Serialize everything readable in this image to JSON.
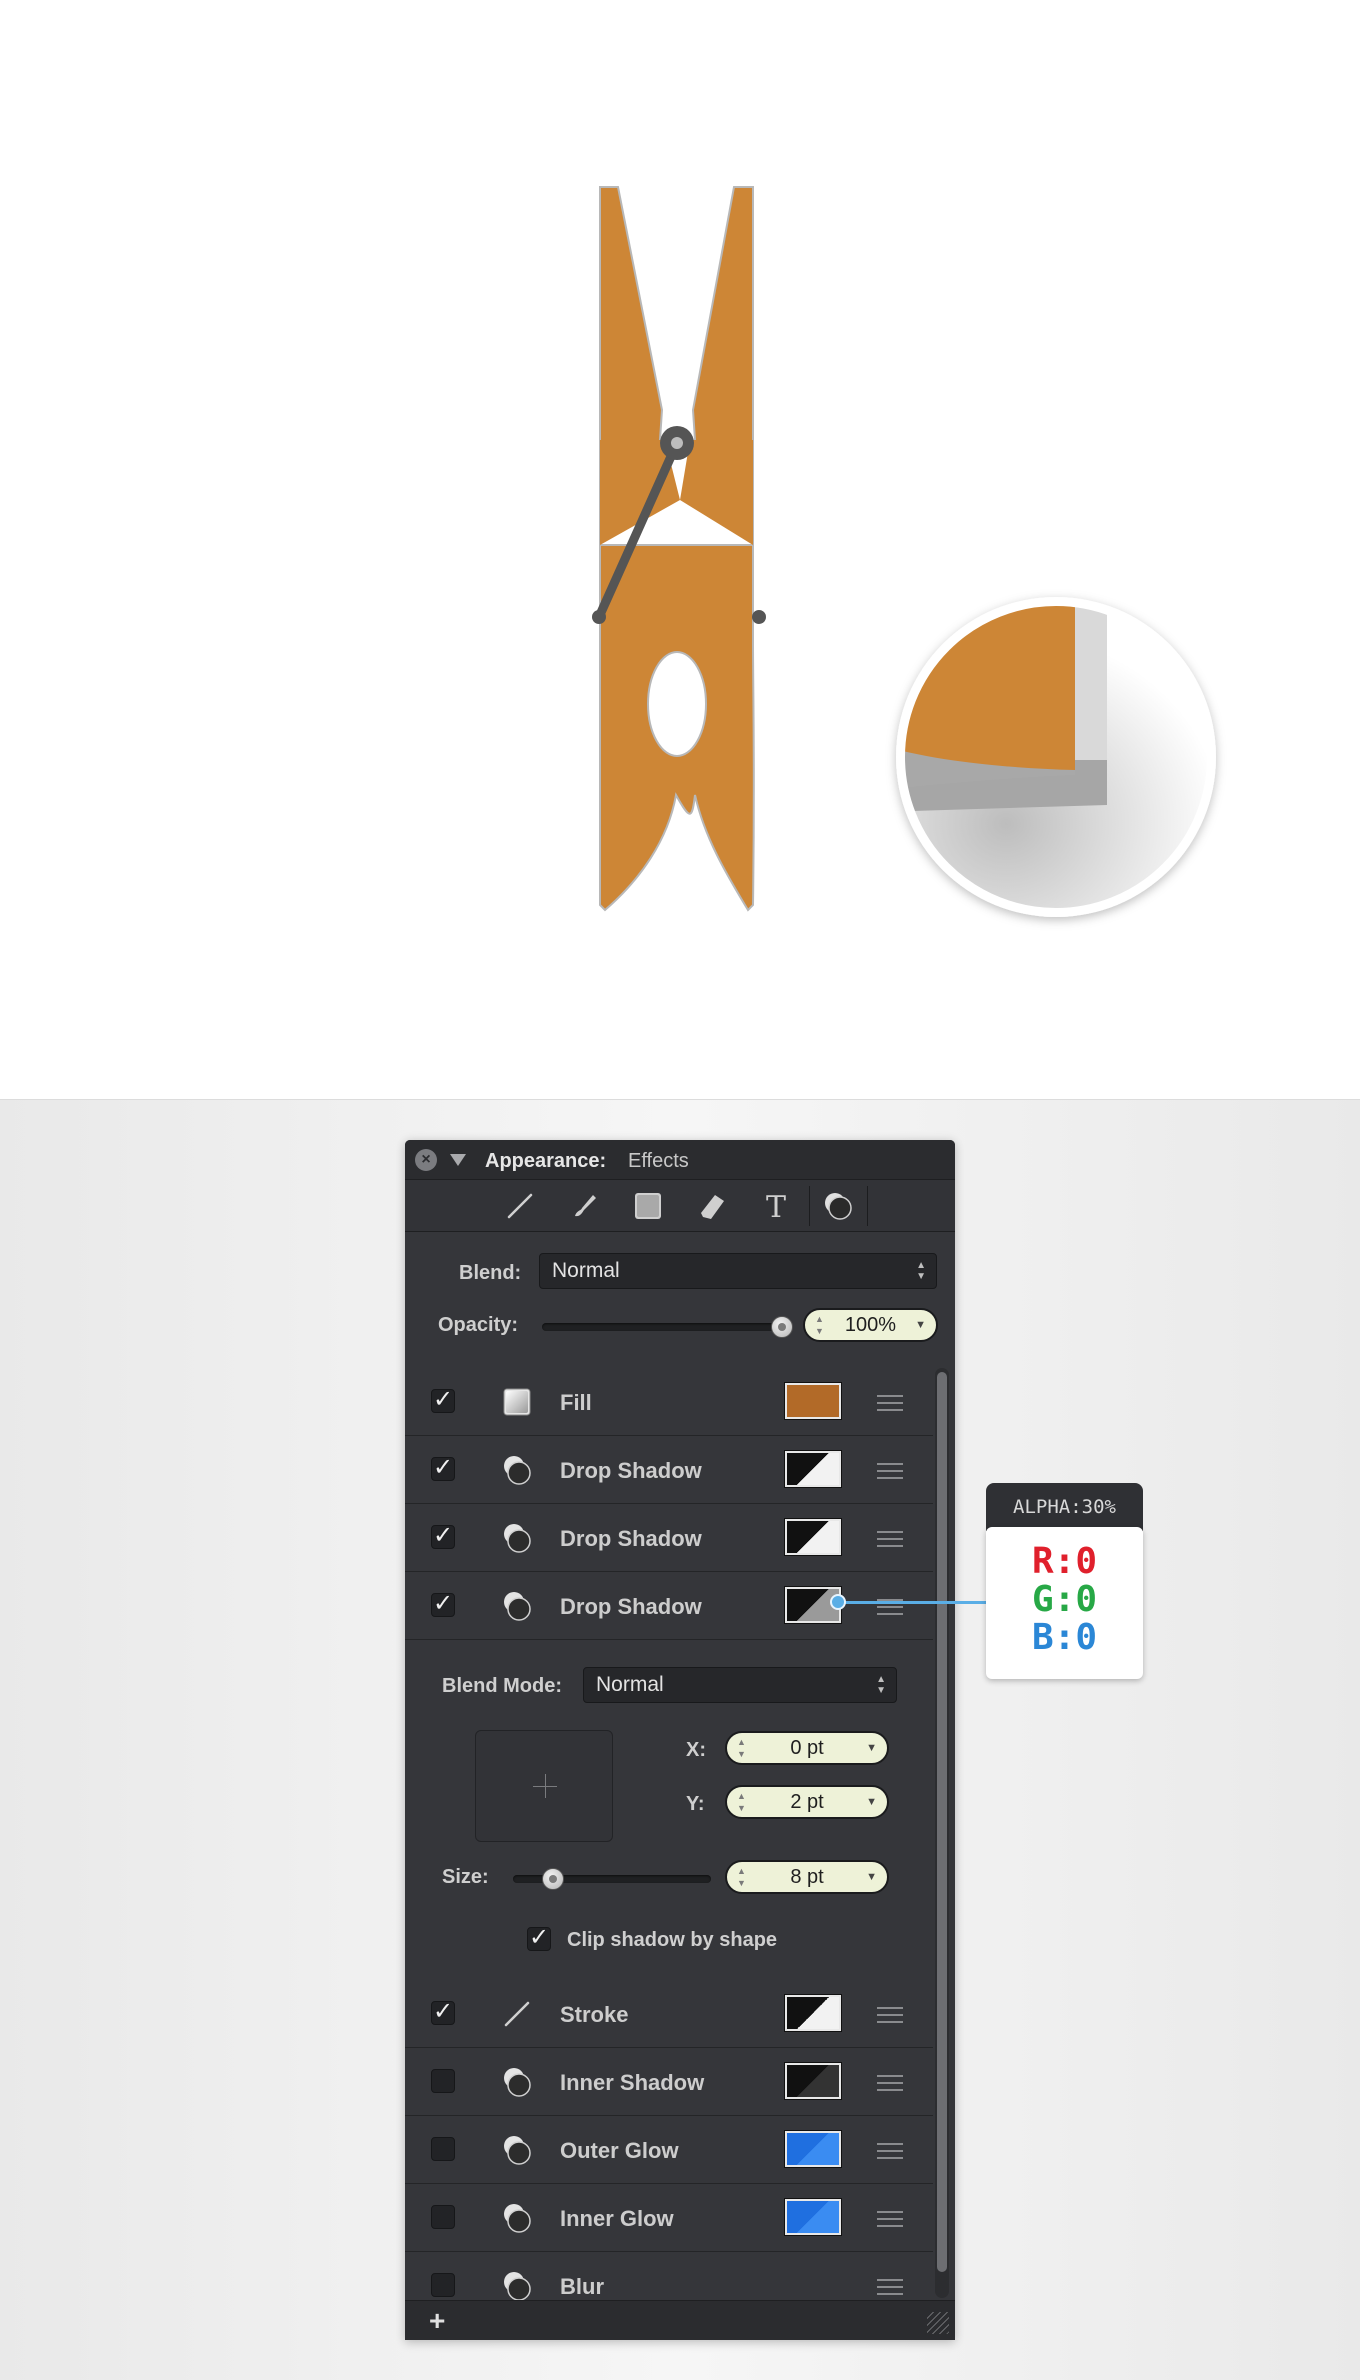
{
  "panel": {
    "title": "Appearance:",
    "subtitle": "Effects",
    "tools": [
      "stroke-tool-icon",
      "brush-tool-icon",
      "fill-tool-icon",
      "tag-tool-icon",
      "text-tool-icon",
      "effects-tool-icon"
    ],
    "blend_label": "Blend:",
    "blend_value": "Normal",
    "opacity_label": "Opacity:",
    "opacity_value": "100%",
    "opacity_fraction": 1.0,
    "effects": [
      {
        "label": "Fill",
        "checked": true,
        "icon": "fill-square-icon",
        "swatch": "#b26a28"
      },
      {
        "label": "Drop Shadow",
        "checked": true,
        "icon": "shadow-icon",
        "swatch": "split-white-black"
      },
      {
        "label": "Drop Shadow",
        "checked": true,
        "icon": "shadow-icon",
        "swatch": "split-white-black"
      },
      {
        "label": "Drop Shadow",
        "checked": true,
        "icon": "shadow-icon",
        "swatch": "split-gray-black"
      }
    ],
    "detail": {
      "blend_mode_label": "Blend Mode:",
      "blend_mode_value": "Normal",
      "x_label": "X:",
      "x_value": "0 pt",
      "y_label": "Y:",
      "y_value": "2 pt",
      "size_label": "Size:",
      "size_value": "8 pt",
      "size_fraction": 0.2,
      "clip_label": "Clip shadow by shape",
      "clip_checked": true
    },
    "more_effects": [
      {
        "label": "Stroke",
        "checked": true,
        "icon": "stroke-line-icon",
        "swatch": "split-white-black"
      },
      {
        "label": "Inner Shadow",
        "checked": false,
        "icon": "shadow-icon",
        "swatch": "split-black-dark"
      },
      {
        "label": "Outer Glow",
        "checked": false,
        "icon": "shadow-icon",
        "swatch": "split-blue"
      },
      {
        "label": "Inner Glow",
        "checked": false,
        "icon": "shadow-icon",
        "swatch": "split-blue"
      },
      {
        "label": "Blur",
        "checked": false,
        "icon": "shadow-icon",
        "swatch": ""
      }
    ],
    "add_label": "+"
  },
  "callout": {
    "alpha": "ALPHA:30%",
    "r": "R:0",
    "g": "G:0",
    "b": "B:0"
  },
  "colors": {
    "clothespin": "#cd8636",
    "spring": "#555555",
    "panel_bg": "#35363a",
    "stepper_bg": "#eef2d8",
    "accent": "#5aaee6",
    "r": "#e0202c",
    "g": "#27a846",
    "b": "#2b87d6"
  }
}
